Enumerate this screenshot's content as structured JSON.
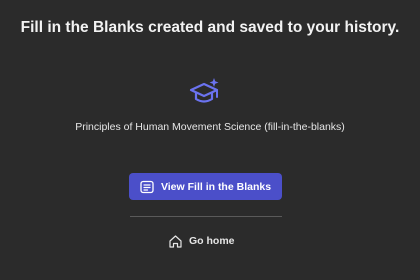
{
  "header": {
    "title": "Fill in the Blanks created and saved to your history."
  },
  "content": {
    "icon": "graduation-cap-sparkle-icon",
    "document_title": "Principles of Human Movement Science (fill-in-the-blanks)"
  },
  "actions": {
    "view_label": "View Fill in the Blanks",
    "view_icon": "document-list-icon",
    "home_label": "Go home",
    "home_icon": "home-icon"
  },
  "colors": {
    "background": "#2b2b2b",
    "accent": "#4b4fc9",
    "icon_accent": "#6b73f0",
    "text": "#f2f2f2",
    "divider": "#5a5a5a"
  }
}
